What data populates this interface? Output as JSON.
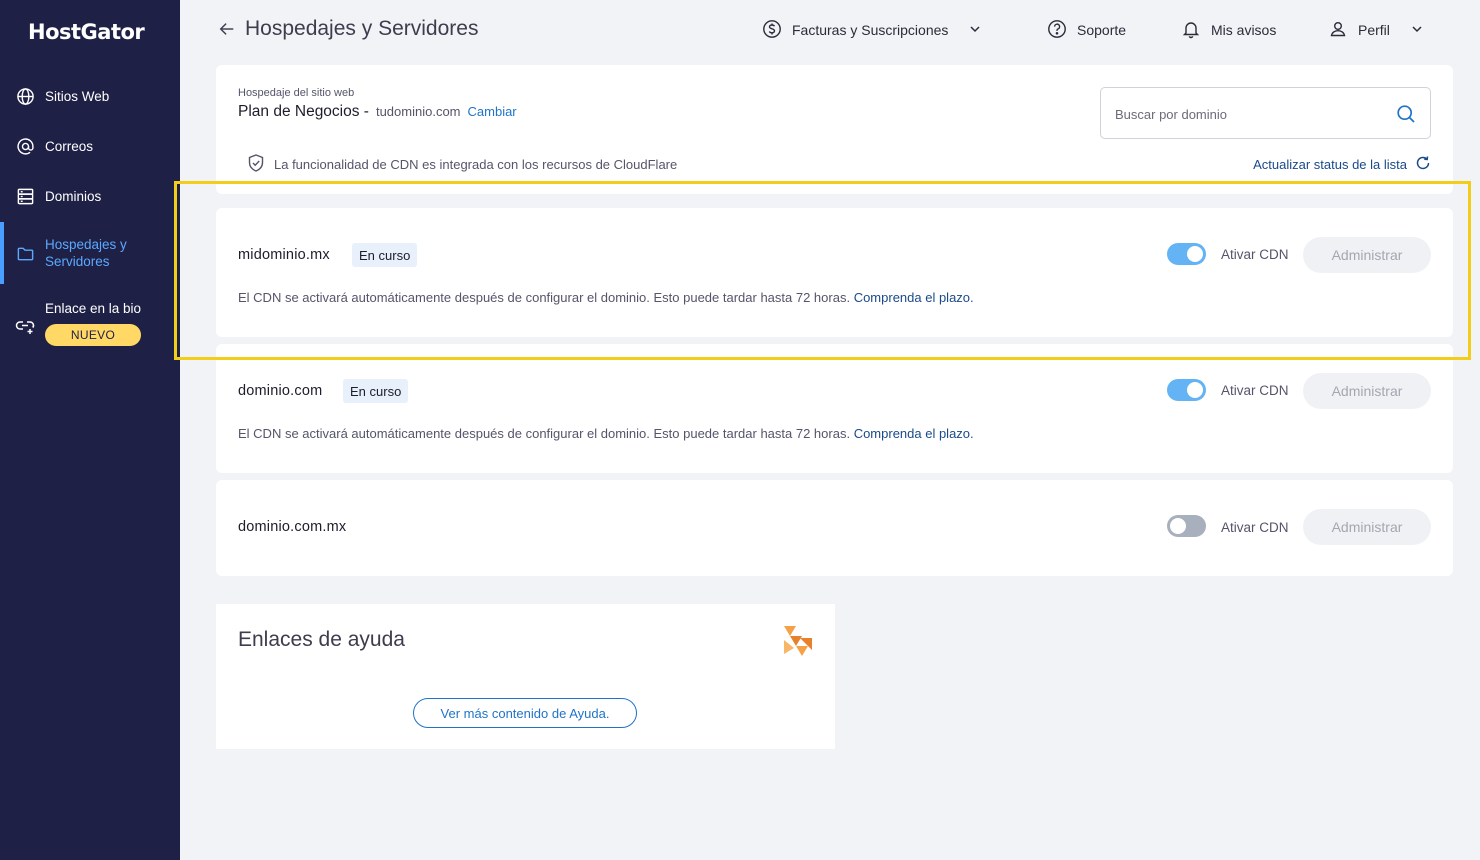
{
  "brand": {
    "name": "HostGator"
  },
  "sidebar": {
    "items": [
      {
        "label": "Sitios Web",
        "icon": "globe-icon"
      },
      {
        "label": "Correos",
        "icon": "at-icon"
      },
      {
        "label": "Dominios",
        "icon": "server-icon"
      },
      {
        "label": "Hospedajes y Servidores",
        "icon": "folder-icon",
        "active": true
      },
      {
        "label": "Enlace en la bio",
        "icon": "link-icon",
        "badge": "NUEVO"
      }
    ]
  },
  "header": {
    "title": "Hospedajes y Servidores",
    "billing": "Facturas y Suscripciones",
    "support": "Soporte",
    "notices": "Mis avisos",
    "profile": "Perfil"
  },
  "plan": {
    "caption": "Hospedaje del sitio web",
    "name": "Plan de Negocios -",
    "domain": "tudominio.com",
    "change": "Cambiar",
    "cdn_note": "La funcionalidad de CDN es integrada con los recursos de CloudFlare",
    "refresh": "Actualizar status de la lista"
  },
  "search": {
    "placeholder": "Buscar por dominio"
  },
  "domains": [
    {
      "name": "midominio.mx",
      "status": "En curso",
      "cdn_on": true,
      "cdn_label": "Ativar CDN",
      "button": "Administrar",
      "note": "El CDN se activará automáticamente después de configurar el dominio. Esto puede tardar hasta 72 horas.",
      "note_link": "Comprenda el plazo."
    },
    {
      "name": "dominio.com",
      "status": "En curso",
      "cdn_on": true,
      "cdn_label": "Ativar CDN",
      "button": "Administrar",
      "note": "El CDN se activará automáticamente después de configurar el dominio. Esto puede tardar hasta 72 horas.",
      "note_link": "Comprenda el plazo."
    },
    {
      "name": "dominio.com.mx",
      "cdn_on": false,
      "cdn_label": "Ativar CDN",
      "button": "Administrar"
    }
  ],
  "help": {
    "title": "Enlaces de ayuda",
    "button": "Ver más contenido de Ayuda."
  },
  "colors": {
    "sidebar_bg": "#1f2045",
    "accent_blue": "#1f74c8",
    "toggle_on": "#64b4f5",
    "badge_new": "#ffd866",
    "highlight": "#f2cd1a"
  }
}
